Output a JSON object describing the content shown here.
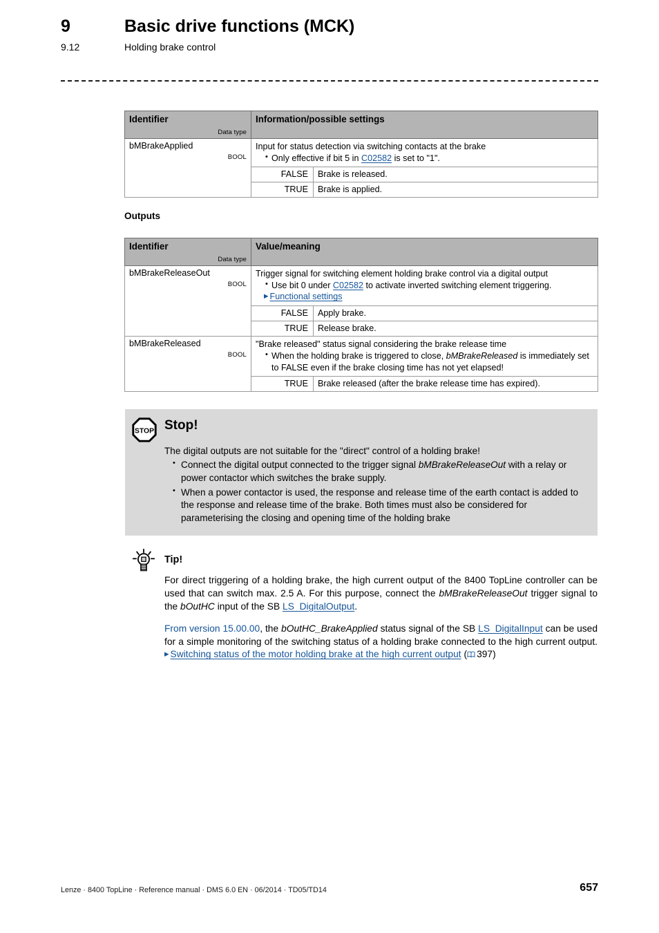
{
  "header": {
    "chapter_number": "9",
    "chapter_title": "Basic drive functions (MCK)",
    "section_number": "9.12",
    "section_title": "Holding brake control"
  },
  "table_inputs": {
    "columns": [
      "Identifier",
      "Information/possible settings"
    ],
    "data_type_label": "Data type",
    "rows": [
      {
        "identifier": "bMBrakeApplied",
        "data_type": "BOOL",
        "lead": "Input for status detection via switching contacts at the brake",
        "bullets_pre": "Only effective if bit 5 in ",
        "bullet_link": "C02582",
        "bullets_post": " is set to \"1\".",
        "values": [
          {
            "name": "FALSE",
            "meaning": "Brake is released."
          },
          {
            "name": "TRUE",
            "meaning": "Brake is applied."
          }
        ]
      }
    ]
  },
  "outputs_caption": "Outputs",
  "table_outputs": {
    "columns": [
      "Identifier",
      "Value/meaning"
    ],
    "data_type_label": "Data type",
    "row1": {
      "identifier": "bMBrakeReleaseOut",
      "data_type": "BOOL",
      "lead": "Trigger signal for switching element holding brake control via a digital output",
      "bullet_pre": "Use bit 0 under ",
      "bullet_link": "C02582",
      "bullet_post": " to activate inverted switching element triggering.",
      "sub_link": "Functional settings",
      "values": [
        {
          "name": "FALSE",
          "meaning": "Apply brake."
        },
        {
          "name": "TRUE",
          "meaning": "Release brake."
        }
      ]
    },
    "row2": {
      "identifier": "bMBrakeReleased",
      "data_type": "BOOL",
      "lead": "\"Brake released\" status signal considering the brake release time",
      "bullet_pre": "When the holding brake is triggered to close, ",
      "bullet_em": "bMBrakeReleased",
      "bullet_post": " is immediately set to FALSE even if the brake closing time has not yet elapsed!",
      "values": [
        {
          "name": "TRUE",
          "meaning": "Brake released (after the brake release time has expired)."
        }
      ]
    }
  },
  "stop_box": {
    "icon": "stop-octagon-icon",
    "icon_text": "STOP",
    "title": "Stop!",
    "lead": "The digital outputs are not suitable for the \"direct\" control of a holding brake!",
    "bullet1_pre": "Connect the digital output connected to the trigger signal ",
    "bullet1_em": "bMBrakeReleaseOut",
    "bullet1_post": " with a relay or power contactor which switches the brake supply.",
    "bullet2": "When a power contactor is used, the response and release time of the earth contact is added to the response and release time of the brake. Both times must also be considered for parameterising the closing and opening time of the holding brake"
  },
  "tip_box": {
    "icon": "lightbulb-icon",
    "title": "Tip!",
    "p1_a": "For direct triggering of a holding brake, the high current output of the 8400 TopLine controller can be used that can switch max. 2.5 A. For this purpose, connect the ",
    "p1_em1": "bMBrakeReleaseOut",
    "p1_b": " trigger signal to the ",
    "p1_em2": "bOutHC",
    "p1_c": " input of the SB ",
    "p1_link": "LS_DigitalOutput",
    "p1_d": ".",
    "p2_version": "From version 15.00.00",
    "p2_a": ", the ",
    "p2_em1": "bOutHC_BrakeApplied",
    "p2_b": " status signal of the SB ",
    "p2_link1": "LS_DigitalInput",
    "p2_c": " can be used for a simple monitoring of the switching status of a holding brake connected to the high current output. ",
    "p2_link2": "Switching status of the motor holding brake at the high current output",
    "p2_page_ref": "397"
  },
  "footer": {
    "left": "Lenze · 8400 TopLine · Reference manual · DMS 6.0 EN · 06/2014 · TD05/TD14",
    "page_number": "657"
  },
  "colors": {
    "link": "#15559a",
    "table_header_bg": "#b4b4b4",
    "stop_box_bg": "#d9d9d9"
  }
}
